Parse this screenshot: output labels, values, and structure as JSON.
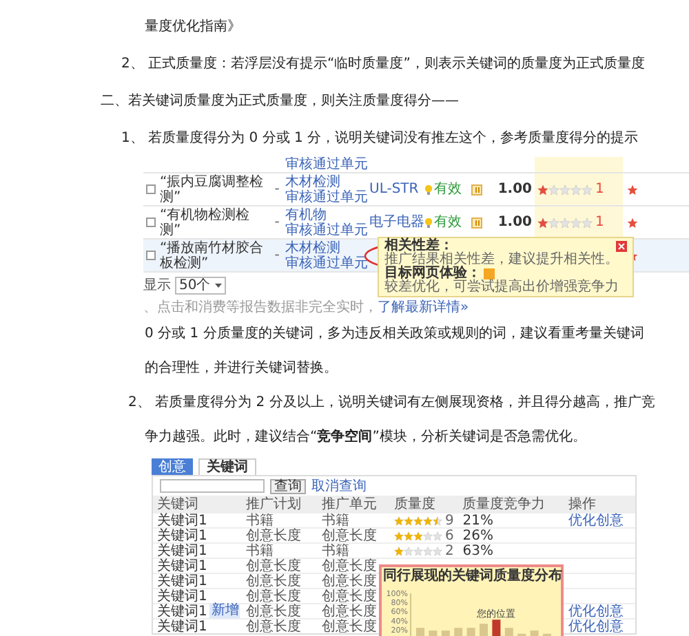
{
  "content": [
    {
      "kind": "continuation",
      "text": "量度优化指南》"
    },
    {
      "kind": "item",
      "text": "2、 正式质量度：若浮层没有提示“临时质量度”，则表示关键词的质量度为正式质量度"
    },
    {
      "kind": "section",
      "text": "二、若关键词质量度为正式质量度，则关注质量度得分——"
    },
    {
      "kind": "item",
      "text": "1、 若质量度得分为 0 分或 1 分，说明关键词没有推左这个，参考质量度得分的提示"
    },
    {
      "kind": "keyword_table",
      "rows": [
        {
          "unit": [
            "审核通过单元"
          ],
          "highlighted": false
        },
        {
          "checked": false,
          "keyword": "“振内豆腐调整检测”",
          "plan": "-",
          "unit": [
            "木材检测",
            "审核通过单元"
          ],
          "tag": "UL-STR",
          "status": "有效",
          "bid": "1.00",
          "stars": 1,
          "score": "1",
          "highlighted": false
        },
        {
          "checked": false,
          "keyword": "“有机物检测检测”",
          "plan": "-",
          "unit": [
            "有机物",
            "审核通过单元"
          ],
          "tag": "电子电器",
          "status": "有效",
          "bid": "1.00",
          "stars": 1,
          "score": "1",
          "highlighted": false
        },
        {
          "checked": false,
          "keyword": "“播放南竹材胶合板检测”",
          "plan": "-",
          "unit": [
            "木材检测",
            "审核通过单元"
          ],
          "highlighted": true
        }
      ],
      "tooltip": {
        "title": "相关性差：",
        "text": "推广结果相关性差，建议提升相关性。",
        "title2": "目标网页体验：",
        "text2": "较差优化，可尝试提高出价增强竞争力"
      },
      "page_size_label": "显示",
      "page_size": "50个",
      "note": "、点击和消费等报告数据非完全实时，",
      "note_link": "了解最新详情»"
    },
    {
      "kind": "para",
      "text": "0 分或 1 分质量度的关键词，多为违反相关政策或规则的词，建议看重考量关键词的合理性，并进行关键词替换。"
    },
    {
      "kind": "hanging",
      "text": "2、 若质量度得分为 2 分及以上，说明关键词有左侧展现资格，并且得分越高，推广竞争力越强。此时，建议结合“**竞争空间**”模块，分析关键词是否急需优化。"
    },
    {
      "kind": "quality_panel",
      "tabs": [
        {
          "label": "创意",
          "selected": false
        },
        {
          "label": "关键词",
          "selected": true
        }
      ],
      "search_button": "查询",
      "cancel_link": "取消查询",
      "columns": [
        "关键词",
        "推广计划",
        "推广单元",
        "质量度",
        "质量度竞争力",
        "操作"
      ],
      "rows": [
        {
          "keyword": "关键词1",
          "plan": "书籍",
          "unit": "书籍",
          "stars": 4.5,
          "score": "9",
          "percent": "21%",
          "action": "优化创意"
        },
        {
          "keyword": "关键词1",
          "plan": "创意长度",
          "unit": "创意长度",
          "stars": 3,
          "score": "6",
          "percent": "26%"
        },
        {
          "keyword": "关键词1",
          "plan": "书籍",
          "unit": "书籍",
          "stars": 1,
          "score": "2",
          "percent": "63%"
        },
        {
          "keyword": "关键词1",
          "plan": "创意长度",
          "unit": "创意长度"
        },
        {
          "keyword": "关键词1",
          "plan": "创意长度",
          "unit": "创意长度"
        },
        {
          "keyword": "关键词1",
          "plan": "创意长度",
          "unit": "创意长度"
        },
        {
          "keyword": "关键词1",
          "badge": "新增",
          "plan": "创意长度",
          "unit": "创意长度",
          "action": "优化创意"
        },
        {
          "keyword": "关键词1",
          "plan": "创意长度",
          "unit": "创意长度",
          "action": "优化创意"
        }
      ],
      "popup": {
        "title": "同行展现的关键词质量度分布",
        "chart_data": {
          "type": "bar",
          "stacked": true,
          "categories": [
            null,
            null,
            null,
            null,
            null,
            null,
            null,
            null,
            null,
            null,
            null
          ],
          "series": [
            {
              "color": "#d9c78e",
              "values": [
                24,
                18,
                18,
                24,
                24,
                33,
                null,
                24,
                11,
                18,
                11
              ]
            },
            {
              "name": "您的位置",
              "color": "#c0392b",
              "values": [
                null,
                null,
                null,
                null,
                null,
                null,
                42,
                null,
                null,
                null,
                null
              ]
            }
          ],
          "ylim": [
            0,
            100
          ],
          "yticks": [
            {
              "value": 20,
              "label": "20%"
            },
            {
              "value": 40,
              "label": "40%"
            },
            {
              "value": 60,
              "label": "60%"
            },
            {
              "value": 80,
              "label": "80%"
            },
            {
              "value": 100,
              "label": "100%"
            }
          ]
        }
      }
    }
  ]
}
